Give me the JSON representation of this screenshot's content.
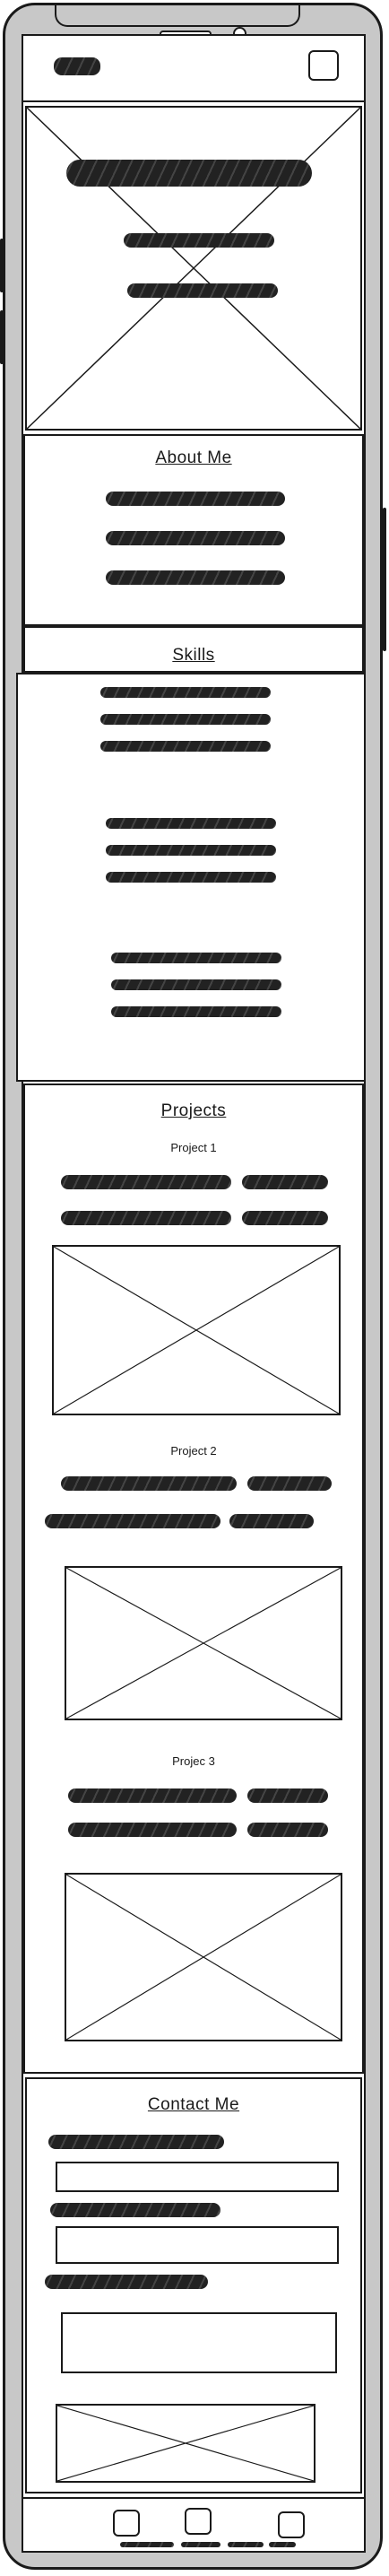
{
  "app": {
    "logo_icon": "scribble-logo",
    "menu_icon": "menu-square-icon"
  },
  "hero": {
    "image_icon": "image-placeholder-icon"
  },
  "about": {
    "title": "About Me"
  },
  "skills": {
    "title": "Skills"
  },
  "projects": {
    "title": "Projects",
    "items": [
      {
        "title": "Project 1"
      },
      {
        "title": "Project 2"
      },
      {
        "title": "Projec 3"
      }
    ]
  },
  "contact": {
    "title": "Contact Me"
  },
  "bottom_nav": {
    "icons": [
      "nav-square-icon",
      "nav-square-icon",
      "nav-square-icon"
    ]
  },
  "colors": {
    "frame": "#c8c8c8",
    "ink": "#1a1a1a",
    "background": "#ffffff"
  }
}
